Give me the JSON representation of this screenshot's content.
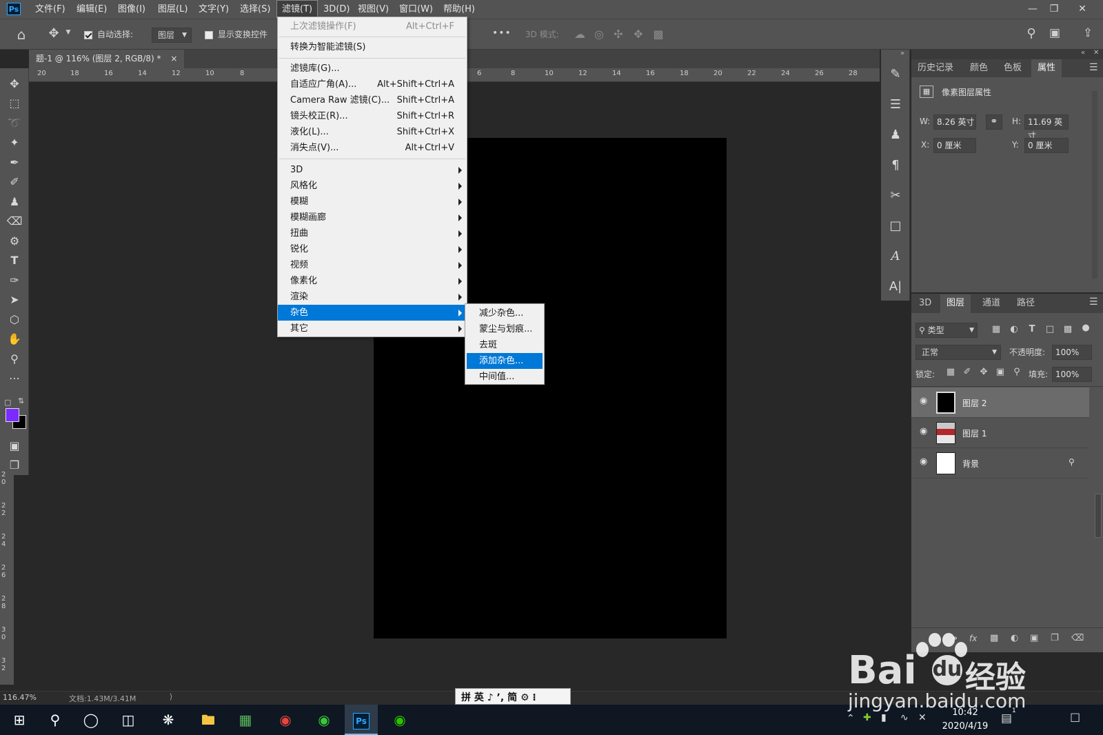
{
  "menubar": {
    "logo": "Ps",
    "items": [
      "文件(F)",
      "编辑(E)",
      "图像(I)",
      "图层(L)",
      "文字(Y)",
      "选择(S)",
      "滤镜(T)",
      "3D(D)",
      "视图(V)",
      "窗口(W)",
      "帮助(H)"
    ],
    "active": "滤镜(T)"
  },
  "options_bar": {
    "auto_select_label": "自动选择:",
    "auto_select_value": "图层",
    "show_transform_label": "显示变换控件",
    "mode_3d_label": "3D 模式:",
    "more": "•••"
  },
  "document_tab": {
    "title": "题-1 @ 116% (图层 2, RGB/8) *",
    "close": "×"
  },
  "ruler": {
    "ticks_left": [
      "20",
      "18",
      "16",
      "14",
      "12",
      "10",
      "8"
    ],
    "ticks_right": [
      "6",
      "8",
      "10",
      "12",
      "14",
      "16",
      "18",
      "20",
      "22",
      "24",
      "26",
      "28"
    ],
    "v_ticks": [
      "2 0",
      "2 2",
      "2 4",
      "2 6",
      "2 8",
      "3 0",
      "3 2"
    ]
  },
  "filter_menu": {
    "group1": [
      {
        "label": "上次滤镜操作(F)",
        "shortcut": "Alt+Ctrl+F",
        "disabled": true
      }
    ],
    "group2": [
      {
        "label": "转换为智能滤镜(S)"
      }
    ],
    "group3": [
      {
        "label": "滤镜库(G)...",
        "shortcut": ""
      },
      {
        "label": "自适应广角(A)...",
        "shortcut": "Alt+Shift+Ctrl+A"
      },
      {
        "label": "Camera Raw 滤镜(C)...",
        "shortcut": "Shift+Ctrl+A"
      },
      {
        "label": "镜头校正(R)...",
        "shortcut": "Shift+Ctrl+R"
      },
      {
        "label": "液化(L)...",
        "shortcut": "Shift+Ctrl+X"
      },
      {
        "label": "消失点(V)...",
        "shortcut": "Alt+Ctrl+V"
      }
    ],
    "group4": [
      "3D",
      "风格化",
      "模糊",
      "模糊画廊",
      "扭曲",
      "锐化",
      "视频",
      "像素化",
      "渲染",
      "杂色",
      "其它"
    ],
    "highlighted": "杂色"
  },
  "noise_submenu": {
    "items": [
      "减少杂色...",
      "蒙尘与划痕...",
      "去斑",
      "添加杂色...",
      "中间值..."
    ],
    "highlighted": "添加杂色..."
  },
  "properties_panel": {
    "tabs": [
      "历史记录",
      "颜色",
      "色板",
      "属性"
    ],
    "active_tab": "属性",
    "heading": "像素图层属性",
    "w_label": "W:",
    "w_value": "8.26 英寸",
    "h_label": "H:",
    "h_value": "11.69 英寸",
    "x_label": "X:",
    "x_value": "0 厘米",
    "y_label": "Y:",
    "y_value": "0 厘米"
  },
  "layers_panel": {
    "tabs": [
      "3D",
      "图层",
      "通道",
      "路径"
    ],
    "active_tab": "图层",
    "filter_label": "类型",
    "blend_mode": "正常",
    "opacity_label": "不透明度:",
    "opacity_value": "100%",
    "lock_label": "锁定:",
    "fill_label": "填充:",
    "fill_value": "100%",
    "layers": [
      {
        "name": "图层 2",
        "selected": true
      },
      {
        "name": "图层 1",
        "selected": false
      },
      {
        "name": "背景",
        "selected": false
      }
    ],
    "footer_fx": "fx"
  },
  "status_bar": {
    "zoom": "116.47%",
    "doc_info": "文档:1.43M/3.41M"
  },
  "ime_bar": {
    "text": "拼 英 ♪ ʼ, 简 ⚙ ⁝"
  },
  "taskbar": {
    "time": "10:42",
    "date": "2020/4/19",
    "notification_count": "1",
    "ps_label": "Ps"
  },
  "watermark": {
    "brand": "Bai",
    "brand2": "经验",
    "url": "jingyan.baidu.com"
  },
  "colors": {
    "foreground": "#7b2bff",
    "background": "#000000",
    "menu_highlight": "#0078d7",
    "ui_panel": "#535353",
    "workspace": "#282828"
  }
}
